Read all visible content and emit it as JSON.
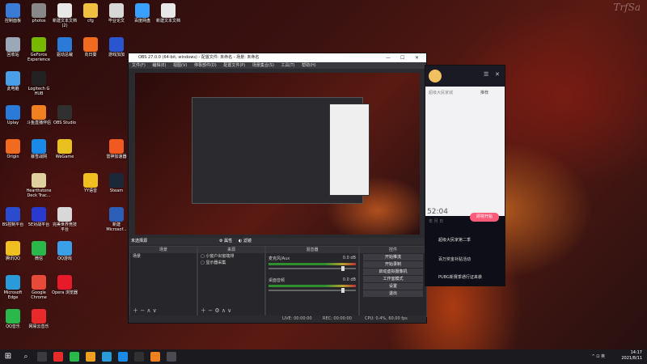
{
  "watermark": "TrfSa",
  "desktop_icons": [
    {
      "label": "控制面板",
      "x": 0,
      "y": 0,
      "color": "#3a7bd5"
    },
    {
      "label": "photos",
      "x": 1,
      "y": 0,
      "color": "#888888"
    },
    {
      "label": "新建文本文档 (2)",
      "x": 2,
      "y": 0,
      "color": "#e8e8e8"
    },
    {
      "label": "cfg",
      "x": 3,
      "y": 0,
      "color": "#f0c040"
    },
    {
      "label": "毕业论文",
      "x": 4,
      "y": 0,
      "color": "#d8d8d8"
    },
    {
      "label": "百度网盘",
      "x": 5,
      "y": 0,
      "color": "#3aa0ff"
    },
    {
      "label": "新建文本文档",
      "x": 6,
      "y": 0,
      "color": "#e8e8e8"
    },
    {
      "label": "回收站",
      "x": 0,
      "y": 1,
      "color": "#9aa8b8"
    },
    {
      "label": "GeForce Experience",
      "x": 1,
      "y": 1,
      "color": "#76b900"
    },
    {
      "label": "驱动总裁",
      "x": 2,
      "y": 1,
      "color": "#2a7ad8"
    },
    {
      "label": "向日葵",
      "x": 3,
      "y": 1,
      "color": "#f06a20"
    },
    {
      "label": "游戏加加",
      "x": 4,
      "y": 1,
      "color": "#2a55d0"
    },
    {
      "label": "此电脑",
      "x": 0,
      "y": 2,
      "color": "#4aa0e8"
    },
    {
      "label": "Logitech G HUB",
      "x": 1,
      "y": 2,
      "color": "#222222"
    },
    {
      "label": "Uplay",
      "x": 0,
      "y": 3,
      "color": "#2a7ad8"
    },
    {
      "label": "斗鱼直播伴侣",
      "x": 1,
      "y": 3,
      "color": "#f08020"
    },
    {
      "label": "OBS Studio",
      "x": 2,
      "y": 3,
      "color": "#303030"
    },
    {
      "label": "Origin",
      "x": 0,
      "y": 4,
      "color": "#f06a20"
    },
    {
      "label": "暴雪战网",
      "x": 1,
      "y": 4,
      "color": "#1a8ae8"
    },
    {
      "label": "WeGame",
      "x": 2,
      "y": 4,
      "color": "#e8c020"
    },
    {
      "label": "雷神加速器",
      "x": 4,
      "y": 4,
      "color": "#f05a20"
    },
    {
      "label": "Hearthstone Deck Trac...",
      "x": 1,
      "y": 5,
      "color": "#e0d0a0"
    },
    {
      "label": "YY语音",
      "x": 3,
      "y": 5,
      "color": "#f0c020"
    },
    {
      "label": "Steam",
      "x": 4,
      "y": 5,
      "color": "#1b2838"
    },
    {
      "label": "BS控制平台",
      "x": 0,
      "y": 6,
      "color": "#2a4ad0"
    },
    {
      "label": "5E对战平台",
      "x": 1,
      "y": 6,
      "color": "#2a3ad0"
    },
    {
      "label": "完美世界竞技平台",
      "x": 2,
      "y": 6,
      "color": "#d8d8d8"
    },
    {
      "label": "新建 Microsof...",
      "x": 4,
      "y": 6,
      "color": "#2b5fb8"
    },
    {
      "label": "腾讯QQ",
      "x": 0,
      "y": 7,
      "color": "#f0c020"
    },
    {
      "label": "微信",
      "x": 1,
      "y": 7,
      "color": "#2ab84a"
    },
    {
      "label": "QQ游戏",
      "x": 2,
      "y": 7,
      "color": "#3aa0e8"
    },
    {
      "label": "Microsoft Edge",
      "x": 0,
      "y": 8,
      "color": "#2a9ad8"
    },
    {
      "label": "Google Chrome",
      "x": 1,
      "y": 8,
      "color": "#e84a3a"
    },
    {
      "label": "Opera 浏览器",
      "x": 2,
      "y": 8,
      "color": "#e81a2a"
    },
    {
      "label": "QQ音乐",
      "x": 0,
      "y": 9,
      "color": "#2ab84a"
    },
    {
      "label": "网易云音乐",
      "x": 1,
      "y": 9,
      "color": "#e82a2a"
    }
  ],
  "obs": {
    "title": "OBS 27.0.0 (64-bit, windows) - 配置文件: 未命名 - 场景: 未命名",
    "menu": [
      "文件(F)",
      "编辑(E)",
      "视图(V)",
      "停靠部件(D)",
      "配置文件(P)",
      "场景集合(S)",
      "工具(T)",
      "帮助(H)"
    ],
    "selection_bar": "未选择源",
    "props_label": "属性",
    "filters_label": "滤镜",
    "scenes_header": "场景",
    "scenes": [
      "场景"
    ],
    "sources_header": "来源",
    "sources": [
      "小窗户出窗端排",
      "显示器采集"
    ],
    "mixer_header": "混音器",
    "mixer": [
      {
        "name": "麦克风/Aux",
        "db": "0.0 dB"
      },
      {
        "name": "桌面音频",
        "db": "0.0 dB"
      }
    ],
    "controls_header": "控件",
    "controls": [
      "开始推流",
      "开始录制",
      "启动虚拟摄像机",
      "工作室模式",
      "设置",
      "退出"
    ],
    "status": {
      "live": "LIVE: 00:00:00",
      "rec": "REC: 00:00:00",
      "cpu": "CPU: 0.4%, 60.00 fps"
    }
  },
  "right_app": {
    "tabs": [
      "超级大民家城",
      "推荐"
    ],
    "time": "52:04",
    "time_sub": "年 月 日",
    "pink_button": "即将开始",
    "list": [
      "超级大民家第二季",
      "百万奖金补贴活动",
      "PUBG新赛季通行证来袭"
    ]
  },
  "taskbar": {
    "time": "14:17",
    "date": "2021/8/11",
    "tray": "^ ⊡ 英"
  }
}
